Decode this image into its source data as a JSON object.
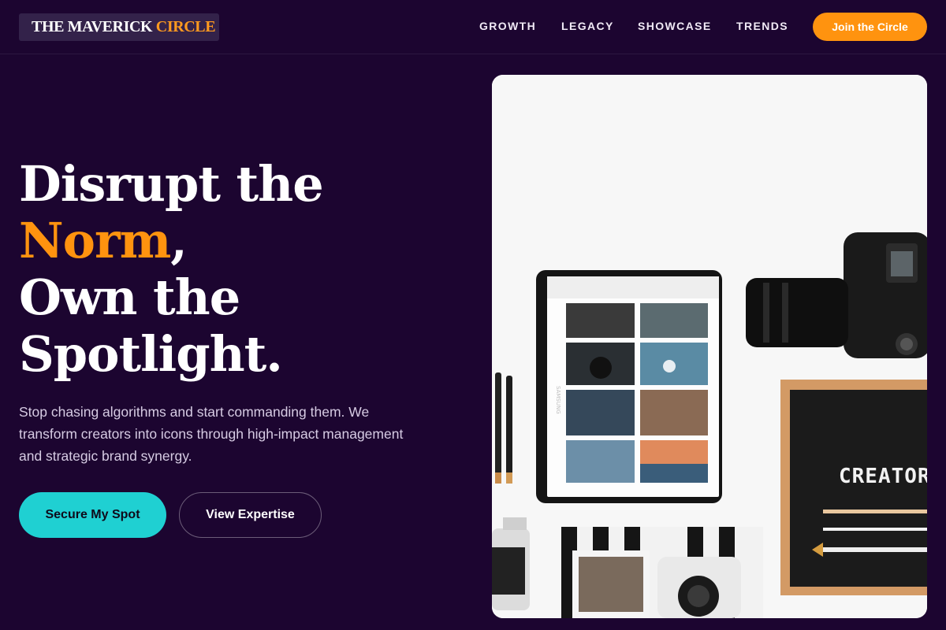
{
  "brand": {
    "name": "THE MAVERICK ",
    "accent": "CIRCLE"
  },
  "nav": {
    "items": [
      {
        "label": "GROWTH"
      },
      {
        "label": "LEGACY"
      },
      {
        "label": "SHOWCASE"
      },
      {
        "label": "TRENDS"
      }
    ],
    "cta_label": "Join the Circle"
  },
  "hero": {
    "headline": {
      "line1": "Disrupt the",
      "highlight": "Norm",
      "comma": ",",
      "line3": "Own the",
      "line4": "Spotlight."
    },
    "subtext": "Stop chasing algorithms and start commanding them. We transform creators into icons through high-impact management and strategic brand synergy.",
    "primary_label": "Secure My Spot",
    "secondary_label": "View Expertise",
    "image": {
      "letterboard_text": "CREATOR",
      "tablet_brand": "SAMSUNG"
    }
  },
  "colors": {
    "background": "#1c0530",
    "accent_orange": "#ff930f",
    "accent_teal": "#1fd0d2"
  }
}
